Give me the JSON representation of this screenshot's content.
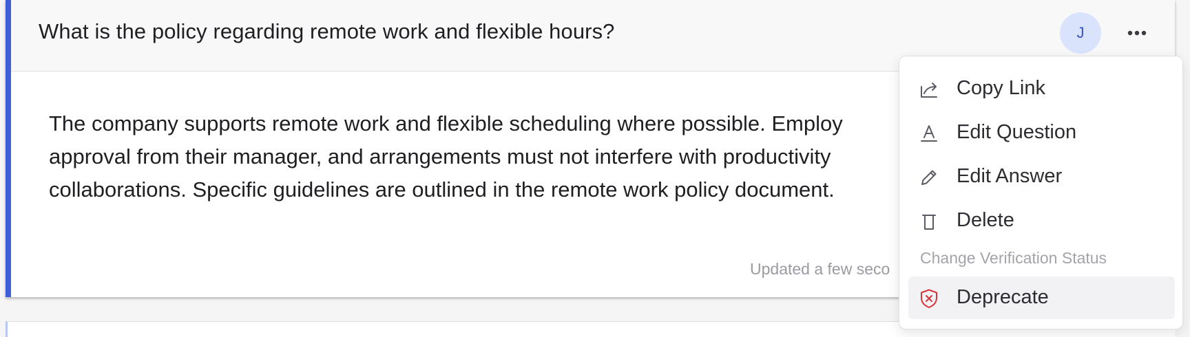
{
  "question": {
    "title": "What is the policy regarding remote work and flexible hours?",
    "author_initial": "J",
    "answer_lines": [
      "The company supports remote work and flexible scheduling where possible. Employ",
      "approval from their manager, and arrangements must not interfere with productivity",
      "collaborations. Specific guidelines are outlined in the remote work policy document."
    ],
    "updated": "Updated a few seco"
  },
  "menu": {
    "items": [
      {
        "label": "Copy Link",
        "icon": "share-arrow-icon"
      },
      {
        "label": "Edit Question",
        "icon": "text-format-icon"
      },
      {
        "label": "Edit Answer",
        "icon": "pencil-icon"
      },
      {
        "label": "Delete",
        "icon": "trash-icon"
      }
    ],
    "section_label": "Change Verification Status",
    "status_items": [
      {
        "label": "Deprecate",
        "icon": "shield-x-icon",
        "highlighted": true
      }
    ]
  },
  "colors": {
    "accent": "#3c5fd7",
    "avatar_bg": "#d9e3fb",
    "avatar_text": "#3953c9",
    "deprecate_icon": "#d8343b",
    "menu_text": "#2c2c31",
    "muted_text": "#9a9aa2"
  }
}
